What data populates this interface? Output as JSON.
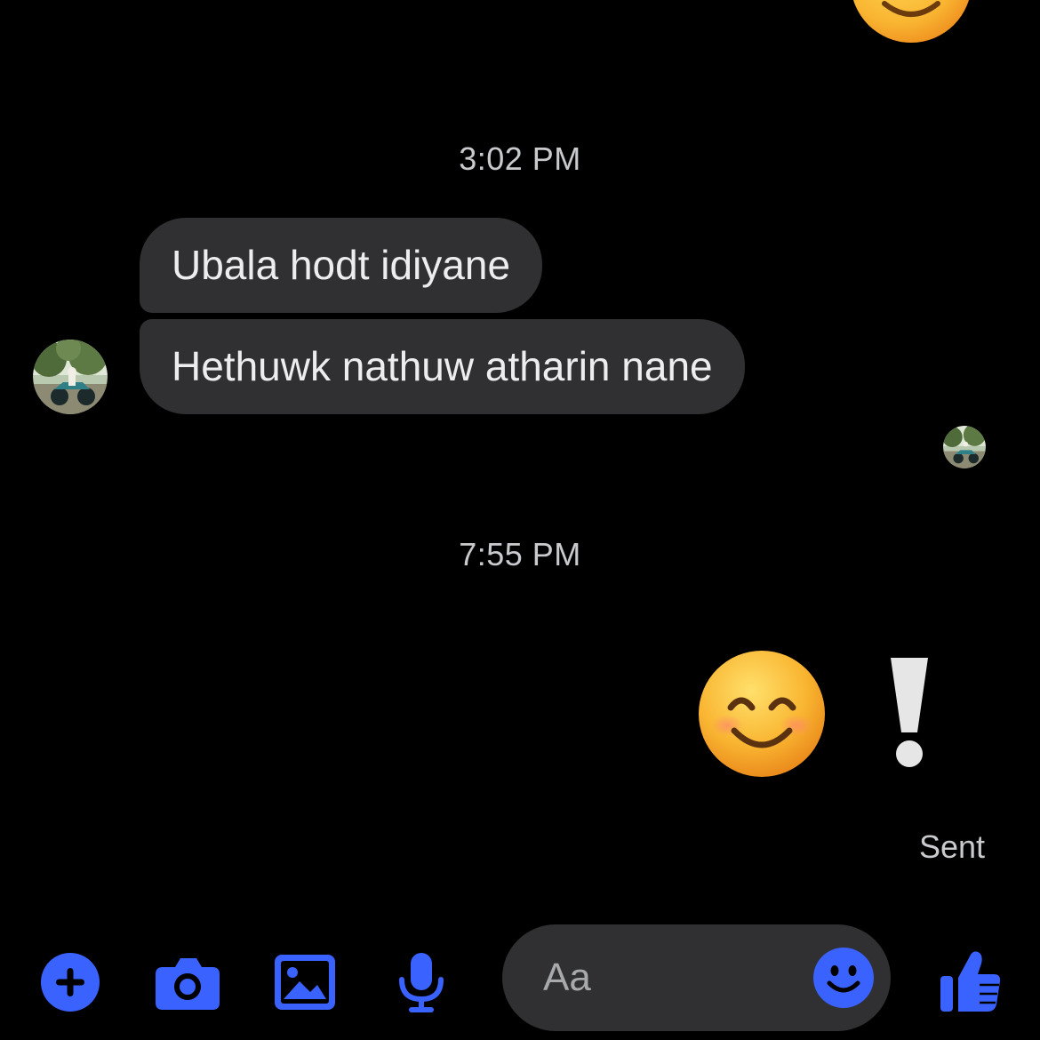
{
  "thread": {
    "timestamps": [
      "3:02 PM",
      "7:55 PM"
    ],
    "incoming_messages": [
      "Ubala hodt idiyane",
      "Hethuwk nathuw atharin nane"
    ],
    "outgoing_emoji": "😊❗",
    "status": "Sent"
  },
  "composer": {
    "placeholder": "Aa",
    "value": ""
  },
  "toolbar": {
    "icons": [
      "plus-icon",
      "camera-icon",
      "image-icon",
      "microphone-icon",
      "emoji-icon",
      "thumbs-up-icon"
    ]
  },
  "colors": {
    "background": "#000000",
    "bubble": "#303033",
    "accent": "#3a62ff",
    "meta_text": "#c9cacd",
    "emoji_yellow": "#f7b531"
  }
}
